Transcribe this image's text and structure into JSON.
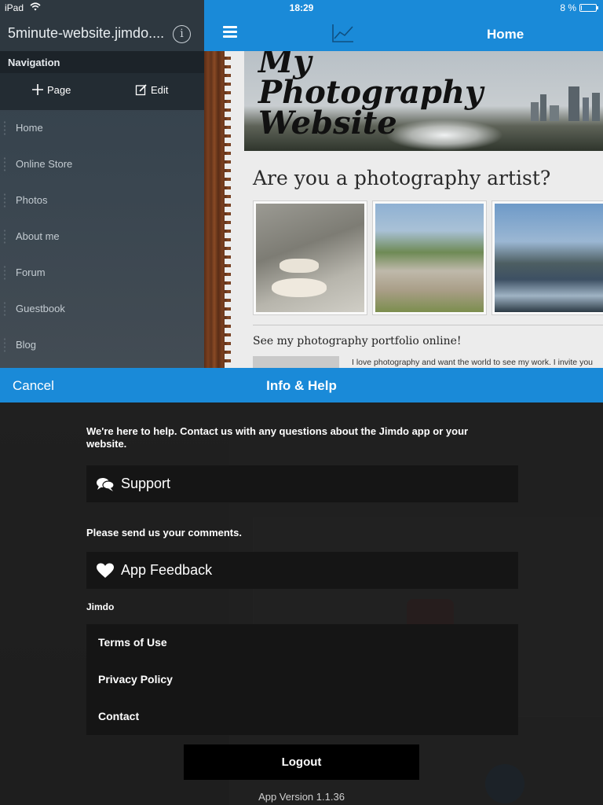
{
  "status_bar": {
    "carrier": "iPad",
    "time": "18:29",
    "battery_text": "8 %",
    "battery_level_percent": 8
  },
  "sidebar": {
    "site_title": "5minute-website.jimdo....",
    "info_icon": "info-icon",
    "nav_heading": "Navigation",
    "add_page_label": "Page",
    "edit_label": "Edit",
    "items": [
      {
        "label": "Home"
      },
      {
        "label": "Online Store"
      },
      {
        "label": "Photos"
      },
      {
        "label": "About me"
      },
      {
        "label": "Forum"
      },
      {
        "label": "Guestbook"
      },
      {
        "label": "Blog"
      }
    ]
  },
  "topbar": {
    "menu_icon": "hamburger-icon",
    "stats_icon": "line-chart-icon",
    "title": "Home"
  },
  "website_preview": {
    "hero_title": "My Photography Website",
    "heading": "Are you a photography artist?",
    "subheading": "See my photography portfolio online!",
    "body_text": "I love photography and want the world to see my work. I invite you",
    "thumbnails": [
      "dogs-photo",
      "house-photo",
      "river-photo"
    ]
  },
  "help_dialog": {
    "cancel_label": "Cancel",
    "title": "Info & Help",
    "intro": "We're here to help. Contact us with any questions about the Jimdo app or your website.",
    "support_label": "Support",
    "support_icon": "chat-bubbles-icon",
    "comments_prompt": "Please send us your comments.",
    "feedback_label": "App Feedback",
    "feedback_icon": "heart-icon",
    "section_label": "Jimdo",
    "links": [
      {
        "label": "Terms of Use"
      },
      {
        "label": "Privacy Policy"
      },
      {
        "label": "Contact"
      }
    ],
    "logout_label": "Logout",
    "version": "App Version 1.1.36"
  },
  "colors": {
    "accent_blue": "#1a8ad8",
    "sidebar_dark": "#2e3840",
    "overlay_black": "#151515"
  }
}
